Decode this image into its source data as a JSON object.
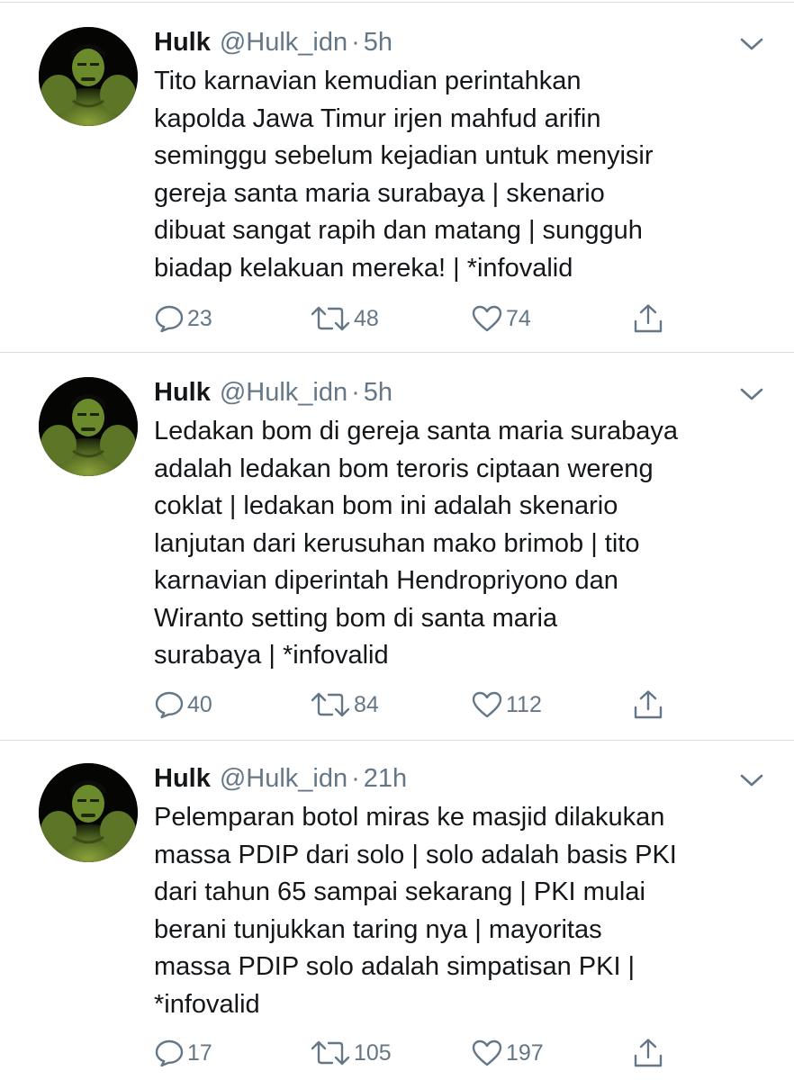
{
  "tweets": [
    {
      "name": "Hulk",
      "handle": "@Hulk_idn",
      "separator": "·",
      "time": "5h",
      "lines": [
        "Tito karnavian kemudian perintahkan",
        "kapolda Jawa Timur irjen mahfud arifin",
        "seminggu sebelum kejadian untuk menyisir",
        "gereja santa maria surabaya | skenario",
        "dibuat sangat rapih dan matang | sungguh",
        "biadap kelakuan mereka! | *infovalid"
      ],
      "replies": "23",
      "retweets": "48",
      "likes": "74"
    },
    {
      "name": "Hulk",
      "handle": "@Hulk_idn",
      "separator": "·",
      "time": "5h",
      "lines": [
        "Ledakan bom di gereja santa maria surabaya",
        "adalah ledakan bom teroris ciptaan wereng",
        "coklat | ledakan bom ini adalah skenario",
        "lanjutan dari kerusuhan mako brimob | tito",
        "karnavian diperintah Hendropriyono dan",
        "Wiranto setting bom di santa maria",
        "surabaya | *infovalid"
      ],
      "replies": "40",
      "retweets": "84",
      "likes": "112"
    },
    {
      "name": "Hulk",
      "handle": "@Hulk_idn",
      "separator": "·",
      "time": "21h",
      "lines": [
        "Pelemparan botol miras ke masjid dilakukan",
        "massa PDIP dari solo | solo adalah basis PKI",
        "dari tahun 65 sampai sekarang | PKI mulai",
        "berani tunjukkan taring nya | mayoritas",
        "massa PDIP solo adalah simpatisan PKI |",
        "*infovalid"
      ],
      "replies": "17",
      "retweets": "105",
      "likes": "197"
    }
  ],
  "icons": {
    "reply": "reply-icon",
    "retweet": "retweet-icon",
    "like": "heart-icon",
    "share": "share-icon",
    "more": "chevron-down-icon",
    "avatar": "hulk-avatar"
  },
  "colors": {
    "text": "#14171a",
    "secondary": "#657786",
    "divider": "#d8dde1",
    "background": "#ffffff"
  }
}
